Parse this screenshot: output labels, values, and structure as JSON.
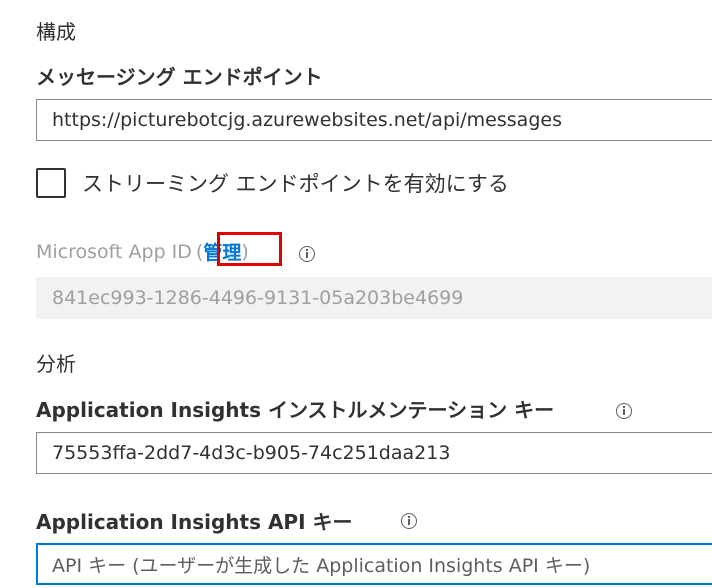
{
  "config": {
    "section_title": "構成",
    "endpoint_label": "メッセージング エンドポイント",
    "endpoint_value": "https://picturebotcjg.azurewebsites.net/api/messages",
    "streaming_label": "ストリーミング エンドポイントを有効にする",
    "streaming_checked": false,
    "app_id_label": "Microsoft App ID",
    "app_id_paren_open": "(",
    "app_id_manage_link": "管理",
    "app_id_paren_close": ")",
    "app_id_value": "841ec993-1286-4496-9131-05a203be4699"
  },
  "analytics": {
    "section_title": "分析",
    "instrumentation_label": "Application Insights インストルメンテーション キー",
    "instrumentation_value": "75553ffa-2dd7-4d3c-b905-74c251daa213",
    "api_key_label": "Application Insights API キー",
    "api_key_placeholder": "API キー (ユーザーが生成した Application Insights API キー)"
  },
  "icons": {
    "info": "info-icon",
    "checkbox": "checkbox-unchecked"
  },
  "colors": {
    "link": "#0078d4",
    "highlight_box": "#e00000",
    "focus_border": "#0078d4",
    "disabled_bg": "#f3f2f1"
  }
}
